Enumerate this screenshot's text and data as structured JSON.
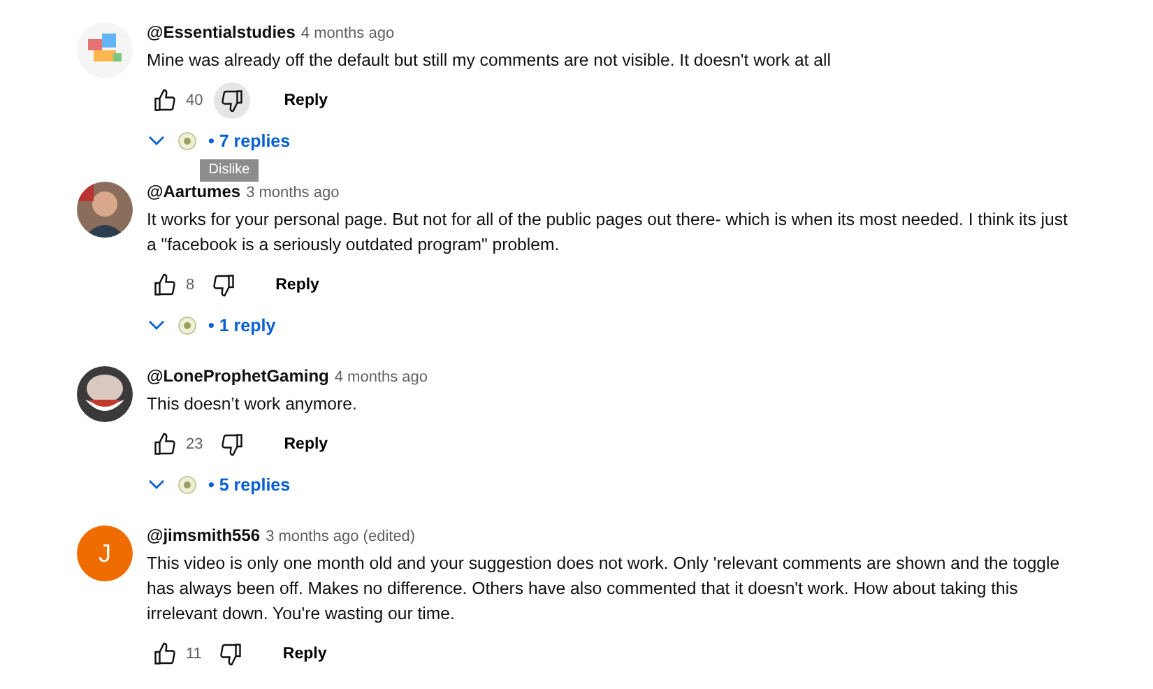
{
  "comments": [
    {
      "author": "@Essentialstudies",
      "time": "4 months ago",
      "text": "Mine was already off the default but still my comments are not visible. It doesn't work at all",
      "likes": "40",
      "dislike_hovered": true,
      "tooltip": "Dislike",
      "reply_label": "Reply",
      "replies": "• 7 replies"
    },
    {
      "author": "@Aartumes",
      "time": "3 months ago",
      "text": "It works for your personal page. But not for all of the public pages out there- which is when its most needed. I think its just a \"facebook is a seriously outdated program\" problem.",
      "likes": "8",
      "dislike_hovered": false,
      "reply_label": "Reply",
      "replies": "• 1 reply"
    },
    {
      "author": "@LoneProphetGaming",
      "time": "4 months ago",
      "text": "This doesn’t work anymore.",
      "likes": "23",
      "dislike_hovered": false,
      "reply_label": "Reply",
      "replies": "• 5 replies"
    },
    {
      "author": "@jimsmith556",
      "time": "3 months ago (edited)",
      "avatar": {
        "kind": "letter",
        "letter": "J"
      },
      "text": "This video is only one month old and your suggestion does not work. Only 'relevant comments are shown and the toggle has always been off. Makes no difference. Others have also commented that it doesn't work. How about taking this irrelevant down. You're wasting our time.",
      "likes": "11",
      "dislike_hovered": false,
      "reply_label": "Reply"
    }
  ]
}
